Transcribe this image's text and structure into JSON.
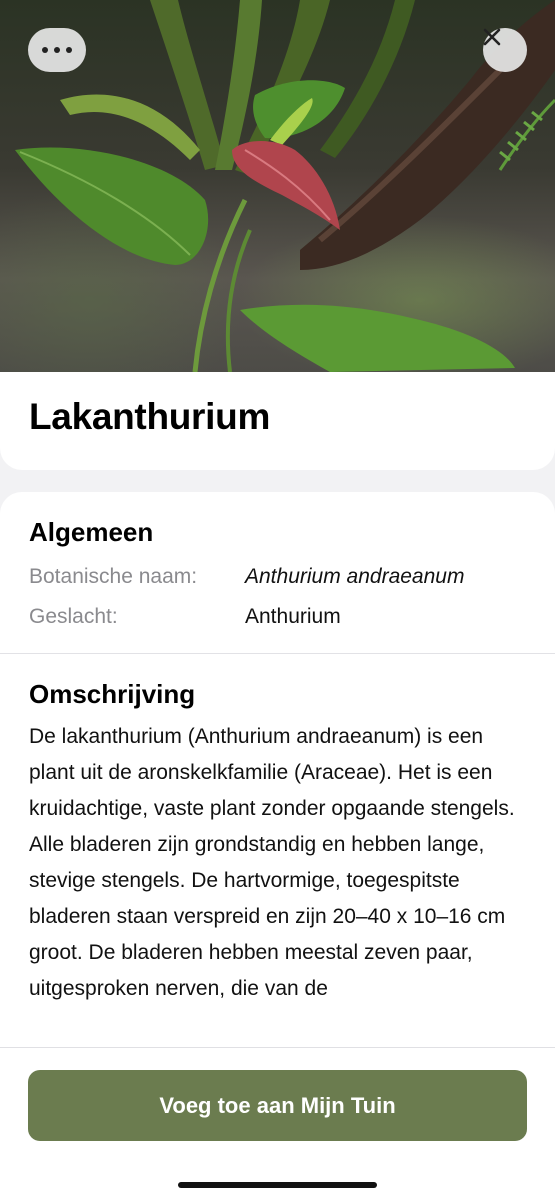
{
  "header": {
    "more_icon": "ellipsis-icon",
    "close_icon": "close-icon",
    "close_glyph": "✕"
  },
  "plant": {
    "name": "Lakanthurium"
  },
  "general": {
    "heading": "Algemeen",
    "rows": [
      {
        "label": "Botanische naam:",
        "value": "Anthurium andraeanum"
      },
      {
        "label": "Geslacht:",
        "value": "Anthurium"
      }
    ]
  },
  "description": {
    "heading": "Omschrijving",
    "text": "De lakanthurium (Anthurium andraeanum) is een plant uit de aronskelkfamilie (Araceae). Het is een kruidachtige, vaste plant zonder opgaande stengels. Alle bladeren zijn grondstandig en hebben lange, stevige stengels. De hartvormige, toegespitste bladeren staan verspreid en zijn 20–40 x 10–16 cm groot. De bladeren hebben meestal zeven paar, uitgesproken nerven, die van de"
  },
  "footer": {
    "add_button_label": "Voeg toe aan Mijn Tuin",
    "accent_color": "#6b7c4f"
  }
}
